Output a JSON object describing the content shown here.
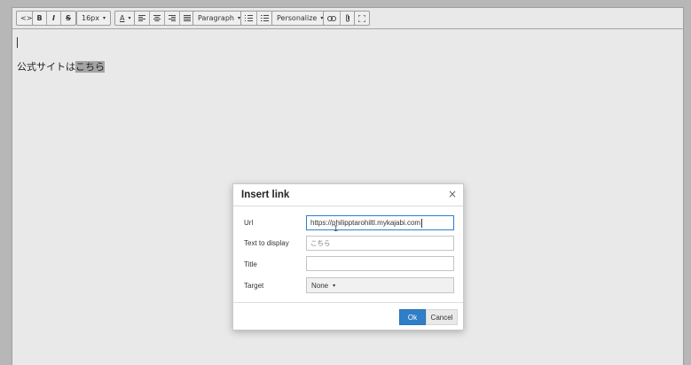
{
  "toolbar": {
    "source_code": "<>",
    "bold": "B",
    "italic": "I",
    "strikethrough": "S",
    "font_size": "16px",
    "text_color": "A",
    "block_format": "Paragraph",
    "personalize": "Personalize",
    "caret": "▾"
  },
  "editor": {
    "text_before_link": "公式サイトは",
    "link_text": "こちら"
  },
  "dialog": {
    "title": "Insert link",
    "close": "×",
    "url_label": "Url",
    "url_value": "https://philipptarohiltl.mykajabi.com",
    "text_label": "Text to display",
    "text_value": "こちら",
    "title_label": "Title",
    "title_value": "",
    "target_label": "Target",
    "target_value": "None",
    "ok_label": "Ok",
    "cancel_label": "Cancel"
  },
  "colors": {
    "overlay": "#b7b7b7",
    "primary_button": "#2f7fc8",
    "focus_border": "#2a7fd0"
  },
  "icons": [
    "code-icon",
    "bold-icon",
    "italic-icon",
    "strikethrough-icon",
    "font-color-icon",
    "align-left-icon",
    "align-center-icon",
    "align-right-icon",
    "align-justify-icon",
    "bullet-list-icon",
    "numbered-list-icon",
    "link-icon",
    "attachment-icon",
    "fullscreen-icon",
    "close-icon"
  ]
}
